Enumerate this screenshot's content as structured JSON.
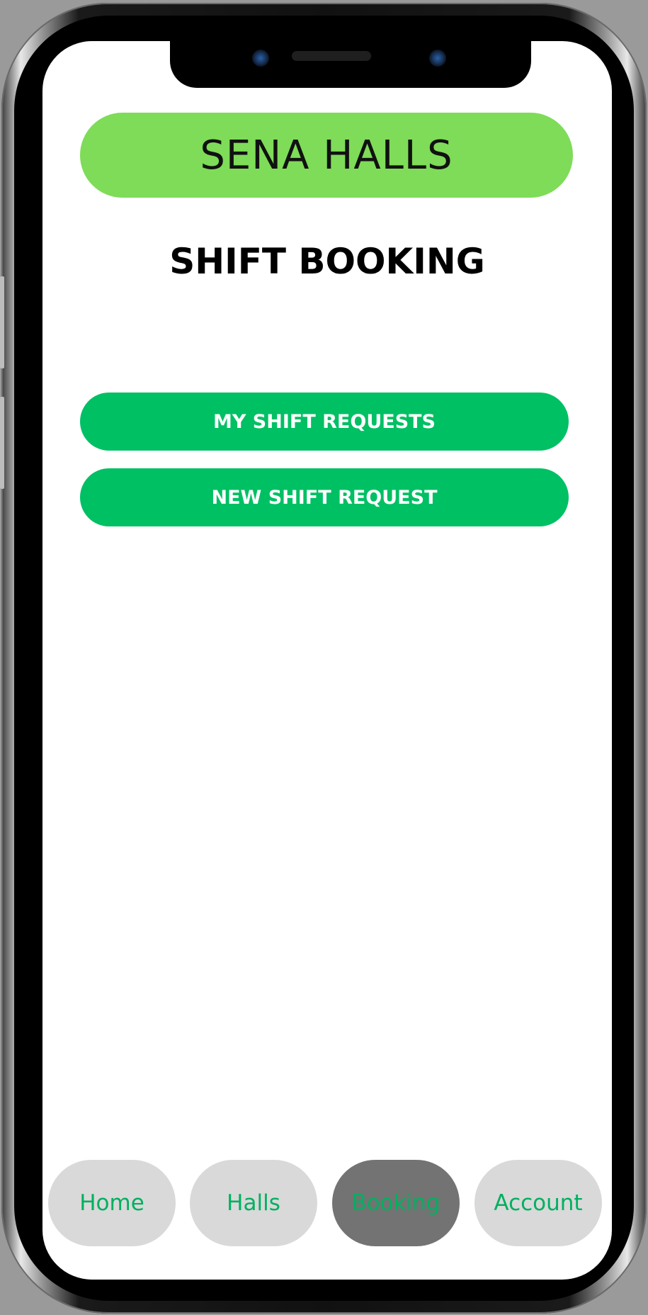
{
  "app": {
    "brand_name": "SENA HALLS",
    "page_title": "SHIFT BOOKING"
  },
  "actions": {
    "my_requests_label": "MY SHIFT REQUESTS",
    "new_request_label": "NEW SHIFT REQUEST"
  },
  "nav": {
    "items": [
      {
        "label": "Home",
        "active": false
      },
      {
        "label": "Halls",
        "active": false
      },
      {
        "label": "Booking",
        "active": true
      },
      {
        "label": "Account",
        "active": false
      }
    ]
  },
  "colors": {
    "brand_green": "#7edc58",
    "action_green": "#00c064",
    "nav_text_green": "#00b060",
    "nav_inactive_bg": "#d9d9d9",
    "nav_active_bg": "#737373"
  }
}
